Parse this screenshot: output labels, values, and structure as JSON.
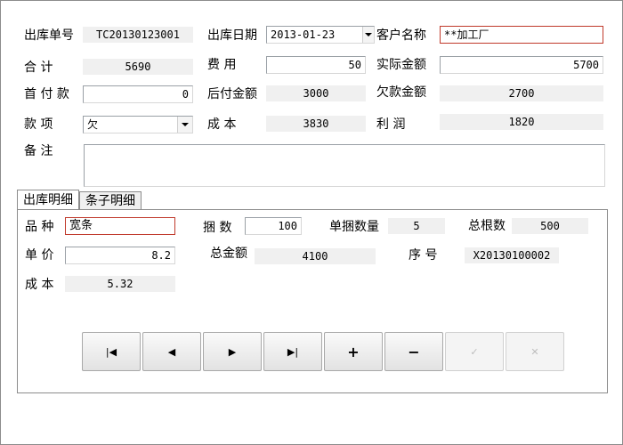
{
  "header": {
    "order_no_label": "出库单号",
    "order_no": "TC20130123001",
    "date_label": "出库日期",
    "date": "2013-01-23",
    "customer_label": "客户名称",
    "customer": "**加工厂",
    "total_label": "合    计",
    "total": "5690",
    "fee_label": "费    用",
    "fee": "50",
    "actual_label": "实际金额",
    "actual": "5700",
    "first_pay_label": "首 付 款",
    "first_pay": "0",
    "later_pay_label": "后付金额",
    "later_pay": "3000",
    "owed_label": "欠款金额",
    "owed": "2700",
    "item_label": "款    项",
    "item": "欠",
    "cost_label": "成    本",
    "cost": "3830",
    "profit_label": "利    润",
    "profit": "1820",
    "note_label": "备    注",
    "note": ""
  },
  "tabs": [
    {
      "label": "出库明细",
      "active": true
    },
    {
      "label": "条子明细",
      "active": false
    }
  ],
  "detail": {
    "variety_label": "品 种",
    "variety": "宽条",
    "bundles_label": "捆  数",
    "bundles": "100",
    "per_bundle_label": "单捆数量",
    "per_bundle": "5",
    "total_count_label": "总根数",
    "total_count": "500",
    "unit_price_label": "单 价",
    "unit_price": "8.2",
    "amount_label": "总金额",
    "amount": "4100",
    "serial_label": "序    号",
    "serial": "X20130100002",
    "cost_label": "成 本",
    "cost": "5.32"
  },
  "nav": {
    "first": "|◀",
    "prev": "◀",
    "next": "▶",
    "last": "▶|",
    "add": "+",
    "delete": "−",
    "post": "✓",
    "cancel": "✕"
  },
  "colors": {
    "accent_red": "#c0392b",
    "readonly_bg": "#f0f0f0"
  }
}
